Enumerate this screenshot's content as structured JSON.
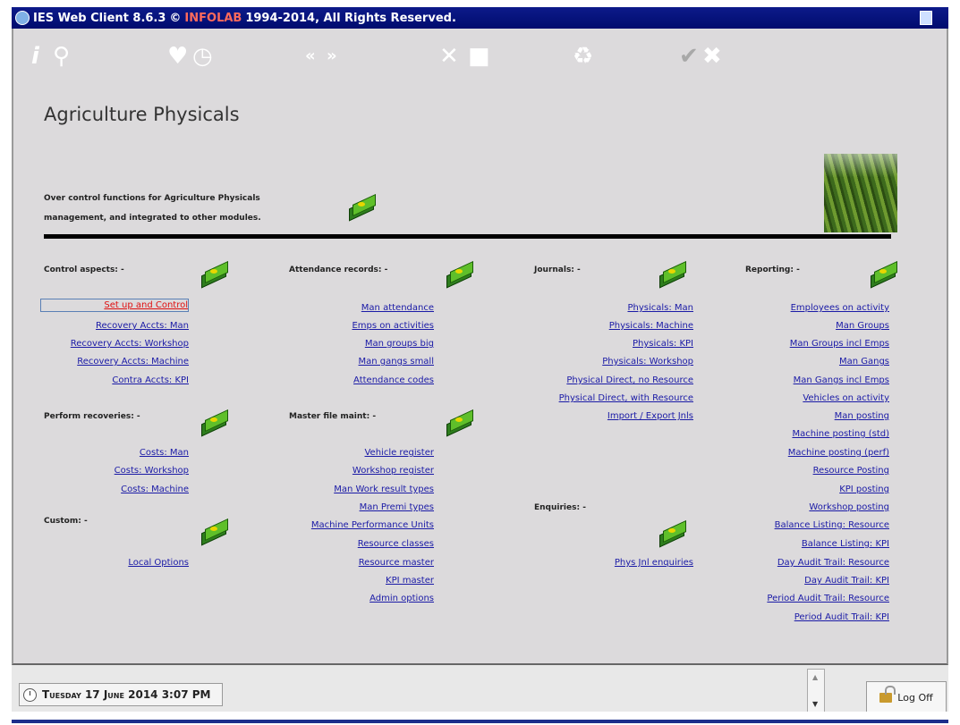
{
  "window": {
    "title_main": "IES Web Client 8.6.3",
    "title_copy": "©",
    "title_brand": "INFOLAB",
    "title_rest": "1994-2014, All Rights Reserved."
  },
  "toolbar": {
    "icons": [
      "info-icon",
      "search-icon",
      "heart-icon",
      "clock-icon",
      "previous-icon",
      "next-icon",
      "tools-icon",
      "stop-icon",
      "recycle-icon",
      "accept-icon",
      "cancel-icon"
    ]
  },
  "page": {
    "title": "Agriculture Physicals",
    "desc_line1": "Over control functions for Agriculture Physicals",
    "desc_line2": "management, and integrated to other modules."
  },
  "sections": {
    "control": {
      "heading": "Control aspects: -",
      "links": [
        "Set up and Control",
        "Recovery Accts: Man",
        "Recovery Accts: Workshop",
        "Recovery Accts: Machine",
        "Contra Accts: KPI"
      ]
    },
    "recoveries": {
      "heading": "Perform recoveries: -",
      "links": [
        "Costs: Man",
        "Costs: Workshop",
        "Costs: Machine"
      ]
    },
    "custom": {
      "heading": "Custom: -",
      "links": [
        "Local Options"
      ]
    },
    "attendance": {
      "heading": "Attendance records: -",
      "links": [
        "Man attendance",
        "Emps on activities",
        "Man groups big",
        "Man gangs small",
        "Attendance codes"
      ]
    },
    "masterfile": {
      "heading": "Master file maint: -",
      "links": [
        "Vehicle register",
        "Workshop register",
        "Man Work result types",
        "Man Premi types",
        "Machine Performance Units",
        "Resource classes",
        "Resource master",
        "KPI master",
        "Admin options"
      ]
    },
    "journals": {
      "heading": "Journals: -",
      "links": [
        "Physicals: Man",
        "Physicals: Machine",
        "Physicals: KPI",
        "Physicals: Workshop",
        "Physical Direct, no Resource",
        "Physical Direct, with Resource",
        "Import / Export Jnls"
      ]
    },
    "enquiries": {
      "heading": "Enquiries: -",
      "links": [
        "Phys Jnl enquiries"
      ]
    },
    "reporting": {
      "heading": "Reporting: -",
      "links": [
        "Employees on activity",
        "Man Groups",
        "Man Groups incl Emps",
        "Man Gangs",
        "Man Gangs incl Emps",
        "Vehicles on activity",
        "Man posting",
        "Machine posting (std)",
        "Machine posting (perf)",
        "Resource Posting",
        "KPI posting",
        "Workshop posting",
        "Balance Listing: Resource",
        "Balance Listing: KPI",
        "Day Audit Trail: Resource",
        "Day Audit Trail: KPI",
        "Period Audit Trail: Resource",
        "Period Audit Trail: KPI"
      ]
    }
  },
  "status": {
    "date": "Tuesday 17 June 2014 3:07 PM",
    "logoff_label": "Log Off"
  },
  "colors": {
    "titlebar": "#0d1a8a",
    "panel": "#dcdadc",
    "link": "#1a1aa6",
    "active_link": "#e01010"
  }
}
